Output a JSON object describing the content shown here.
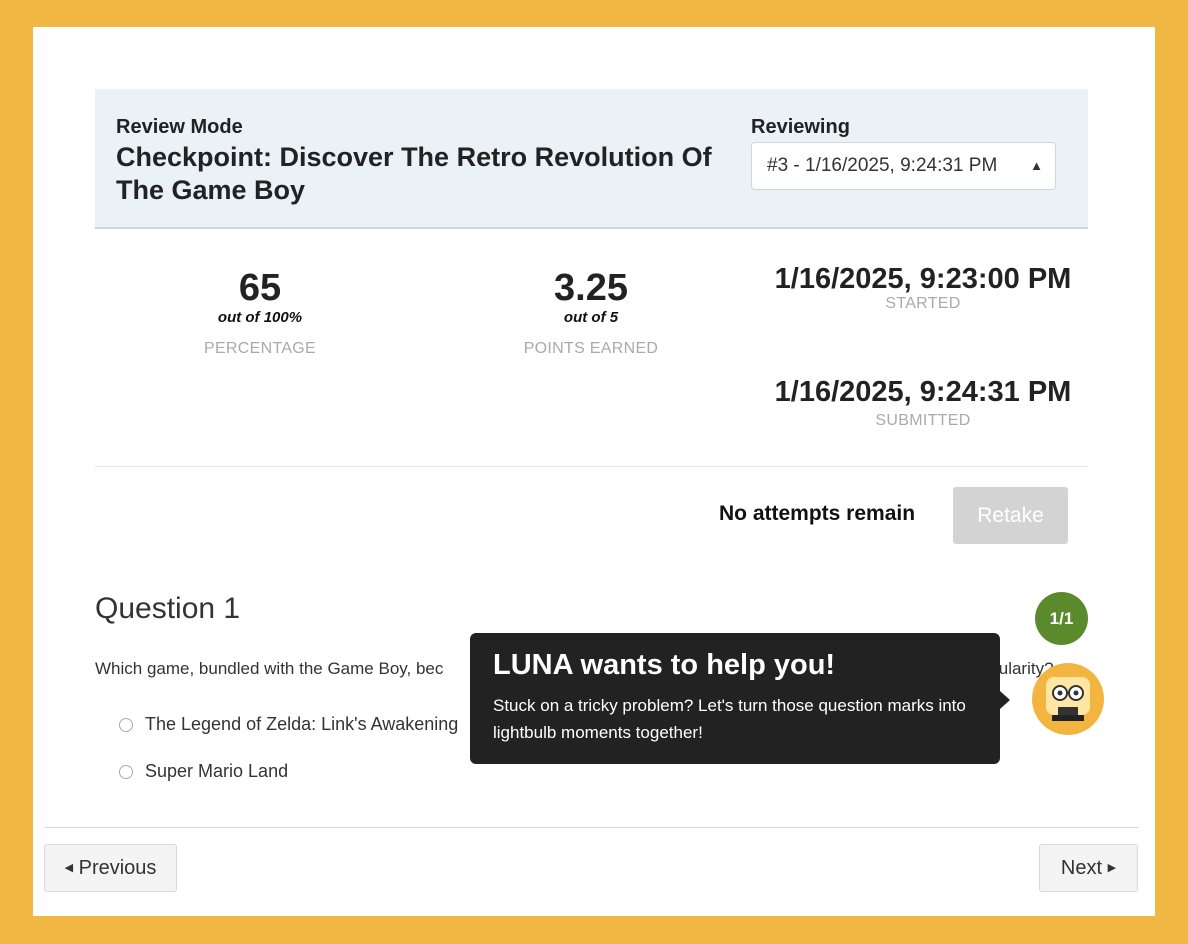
{
  "header": {
    "mode_label": "Review Mode",
    "title": "Checkpoint: Discover The Retro Revolution Of The Game Boy",
    "reviewing_label": "Reviewing",
    "attempt_selected": "#3 - 1/16/2025, 9:24:31 PM",
    "select_icon": "sort-arrows-icon"
  },
  "stats": {
    "percentage_value": "65",
    "percentage_sub": "out of 100%",
    "percentage_caption": "PERCENTAGE",
    "points_value": "3.25",
    "points_sub": "out of 5",
    "points_caption": "POINTS EARNED",
    "started_value": "1/16/2025, 9:23:00 PM",
    "started_caption": "STARTED",
    "submitted_value": "1/16/2025, 9:24:31 PM",
    "submitted_caption": "SUBMITTED"
  },
  "attempts": {
    "status": "No attempts remain",
    "retake_label": "Retake"
  },
  "question": {
    "title": "Question 1",
    "score": "1/1",
    "text_start": "Which game, bundled with the Game Boy, bec",
    "text_end": "popularity?",
    "options": [
      "The Legend of Zelda: Link's Awakening",
      "Super Mario Land"
    ]
  },
  "tooltip": {
    "title": "LUNA wants to help you!",
    "body": "Stuck on a tricky problem? Let's turn those question marks into lightbulb moments together!"
  },
  "luna": {
    "icon": "luna-robot-icon"
  },
  "nav": {
    "previous_label": "Previous",
    "next_label": "Next"
  },
  "colors": {
    "frame": "#f0b843",
    "header_bg": "#eaf1f7",
    "badge": "#5a8a2c",
    "tooltip_bg": "#222222",
    "retake_disabled": "#d3d3d3"
  }
}
